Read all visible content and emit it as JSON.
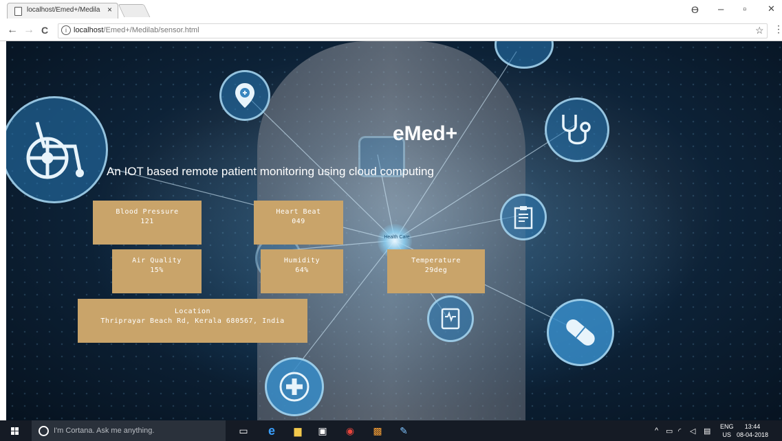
{
  "browser": {
    "tab_title": "localhost/Emed+/Medila",
    "tab_close": "×",
    "url_host": "localhost",
    "url_path": "/Emed+/Medilab/sensor.html",
    "info_icon": "i",
    "back": "←",
    "forward": "→",
    "reload": "C",
    "star": "☆",
    "menu": "⋮",
    "profile": "ϴ",
    "minimize": "–",
    "maximize": "▫",
    "close": "✕"
  },
  "hero": {
    "brand": "eMed+",
    "tagline": "An IOT based remote patient monitoring using cloud computing",
    "hub_label": "Health Care"
  },
  "sensors": {
    "blood_pressure": {
      "label": "Blood Pressure",
      "value": "121"
    },
    "heart_beat": {
      "label": "Heart Beat",
      "value": "049"
    },
    "air_quality": {
      "label": "Air Quality",
      "value": "15%"
    },
    "humidity": {
      "label": "Humidity",
      "value": "64%"
    },
    "temperature": {
      "label": "Temperature",
      "value": "29deg"
    },
    "location": {
      "label": "Location",
      "value": "Thriprayar Beach Rd, Kerala 680567, India"
    }
  },
  "icons": [
    "wheelchair-icon",
    "location-pin-icon",
    "stethoscope-icon",
    "clipboard-icon",
    "monitor-icon",
    "pill-icon",
    "medical-cross-icon",
    "medkit-icon"
  ],
  "taskbar": {
    "cortana_placeholder": "I'm Cortana. Ask me anything.",
    "lang_top": "ENG",
    "lang_bottom": "US",
    "time": "13:44",
    "date": "08-04-2018"
  },
  "colors": {
    "card": "#c9a46a",
    "circle_border": "#aad7f0",
    "taskbar": "#151b25"
  }
}
